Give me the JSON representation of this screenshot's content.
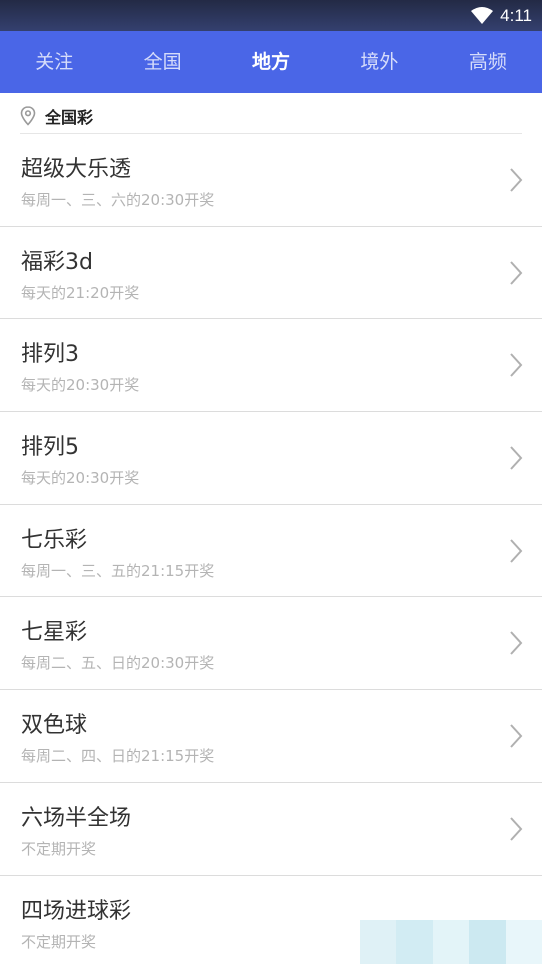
{
  "status_bar": {
    "time": "4:11",
    "icons": [
      "wifi-icon"
    ]
  },
  "tabs": [
    {
      "label": "关注",
      "active": false
    },
    {
      "label": "全国",
      "active": false
    },
    {
      "label": "地方",
      "active": true
    },
    {
      "label": "境外",
      "active": false
    },
    {
      "label": "高频",
      "active": false
    }
  ],
  "section": {
    "icon": "location-pin-icon",
    "title": "全国彩"
  },
  "lotteries": [
    {
      "name": "超级大乐透",
      "schedule": "每周一、三、六的20:30开奖"
    },
    {
      "name": "福彩3d",
      "schedule": "每天的21:20开奖"
    },
    {
      "name": "排列3",
      "schedule": "每天的20:30开奖"
    },
    {
      "name": "排列5",
      "schedule": "每天的20:30开奖"
    },
    {
      "name": "七乐彩",
      "schedule": "每周一、三、五的21:15开奖"
    },
    {
      "name": "七星彩",
      "schedule": "每周二、五、日的20:30开奖"
    },
    {
      "name": "双色球",
      "schedule": "每周二、四、日的21:15开奖"
    },
    {
      "name": "六场半全场",
      "schedule": "不定期开奖"
    },
    {
      "name": "四场进球彩",
      "schedule": "不定期开奖"
    }
  ],
  "colors": {
    "tab_bar": "#4a66e7",
    "status_bar": "#2b3457",
    "title_text": "#333333",
    "subtitle_text": "#b4b4b4",
    "chevron": "#b0b0b0"
  }
}
